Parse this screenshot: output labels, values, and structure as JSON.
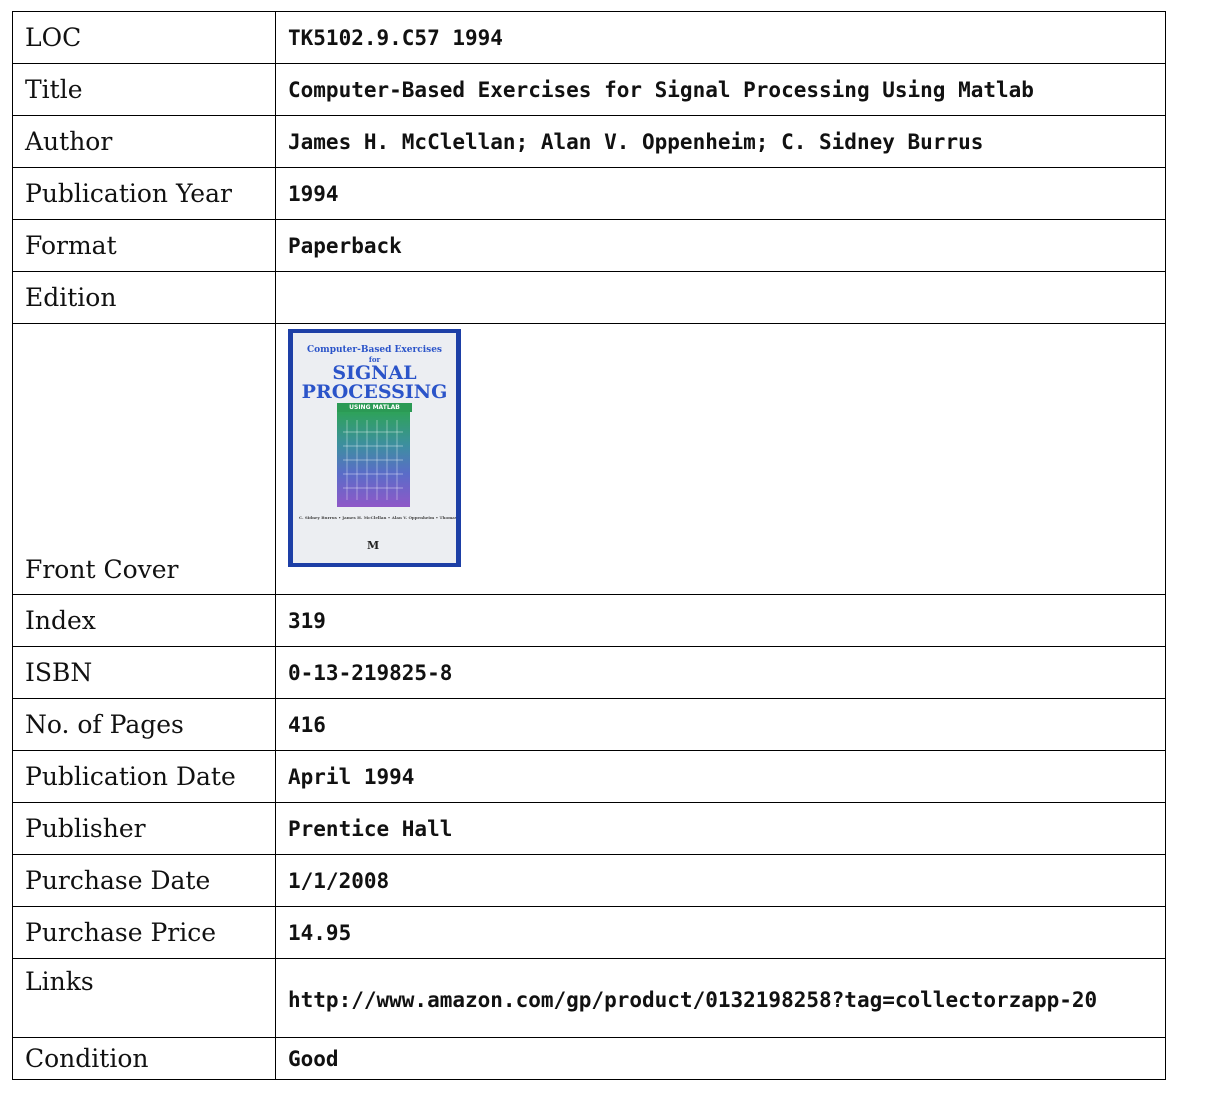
{
  "rows": [
    {
      "label": "LOC",
      "value": "TK5102.9.C57 1994"
    },
    {
      "label": "Title",
      "value": "Computer-Based Exercises for Signal Processing Using Matlab"
    },
    {
      "label": "Author",
      "value": "James H. McClellan; Alan V. Oppenheim; C. Sidney Burrus"
    },
    {
      "label": "Publication Year",
      "value": "1994"
    },
    {
      "label": "Format",
      "value": "Paperback"
    },
    {
      "label": "Edition",
      "value": ""
    },
    {
      "label": "Front Cover"
    },
    {
      "label": "Index",
      "value": "319"
    },
    {
      "label": "ISBN",
      "value": "0-13-219825-8"
    },
    {
      "label": "No. of Pages",
      "value": "416"
    },
    {
      "label": "Publication Date",
      "value": "April 1994"
    },
    {
      "label": "Publisher",
      "value": "Prentice Hall"
    },
    {
      "label": "Purchase Date",
      "value": "1/1/2008"
    },
    {
      "label": "Purchase Price",
      "value": "14.95"
    },
    {
      "label": "Links",
      "value": "http://www.amazon.com/gp/product/0132198258?tag=collectorzapp-20"
    },
    {
      "label": "Condition",
      "value": "Good"
    }
  ],
  "cover": {
    "line1": "Computer-Based Exercises",
    "line2": "for",
    "line3": "SIGNAL",
    "line4": "PROCESSING",
    "banner": "USING MATLAB",
    "authors": "C. Sidney Burrus • James H. McClellan • Alan V. Oppenheim • Thomas W. Parks • Ronald W. Schafer • Hans W. Schuessler",
    "logo": "M",
    "colors": {
      "frame": "#1d3fa6",
      "title": "#2b54c9",
      "banner": "#2b9a55"
    }
  }
}
